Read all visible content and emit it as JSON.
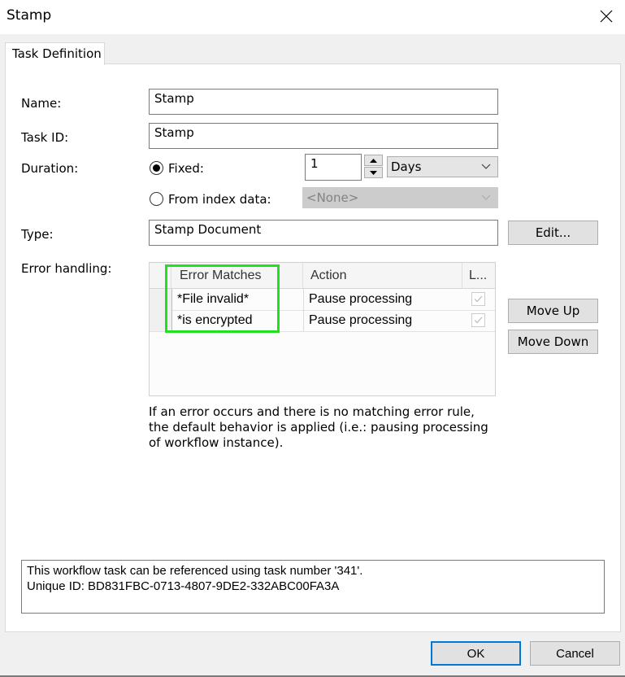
{
  "window": {
    "title": "Stamp",
    "close_icon": "close-icon"
  },
  "tabs": [
    {
      "label": "Task Definition",
      "active": true
    }
  ],
  "form": {
    "name": {
      "label": "Name:",
      "value": "Stamp"
    },
    "task_id": {
      "label": "Task ID:",
      "value": "Stamp"
    },
    "duration": {
      "label": "Duration:",
      "fixed": {
        "label": "Fixed:",
        "checked": true,
        "value": "1",
        "unit": "Days"
      },
      "from_index": {
        "label": "From index data:",
        "checked": false,
        "value": "<None>",
        "disabled": true
      }
    },
    "type": {
      "label": "Type:",
      "value": "Stamp Document",
      "edit_button": "Edit..."
    },
    "error_handling": {
      "label": "Error handling:",
      "columns": [
        "Error Matches",
        "Action",
        "L..."
      ],
      "rows": [
        {
          "match": "*File invalid*",
          "action": "Pause processing",
          "checked": true
        },
        {
          "match": "*is encrypted",
          "action": "Pause processing",
          "checked": true
        }
      ],
      "move_up": "Move Up",
      "move_down": "Move Down",
      "highlight_color": "#22e01f"
    },
    "note": "If an error occurs and there is no matching error rule, the default behavior is applied (i.e.: pausing processing of workflow instance)."
  },
  "info": {
    "line1": "This workflow task can be referenced using task number '341'.",
    "line2": "Unique ID: BD831FBC-0713-4807-9DE2-332ABC00FA3A"
  },
  "footer": {
    "ok": "OK",
    "cancel": "Cancel"
  }
}
